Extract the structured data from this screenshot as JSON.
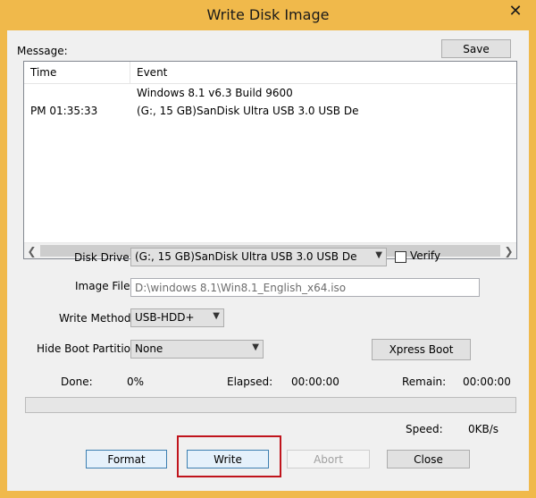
{
  "window": {
    "title": "Write Disk Image",
    "close_glyph": "✕"
  },
  "message_label": "Message:",
  "save_label": "Save",
  "log": {
    "columns": [
      "Time",
      "Event"
    ],
    "rows": [
      {
        "time": "",
        "event": "Windows 8.1 v6.3 Build 9600"
      },
      {
        "time": "PM 01:35:33",
        "event": "(G:, 15 GB)SanDisk Ultra USB 3.0 USB De"
      }
    ]
  },
  "disk_drive": {
    "label": "Disk Drive:",
    "value": "(G:, 15 GB)SanDisk Ultra USB 3.0 USB De"
  },
  "verify": {
    "label": "Verify",
    "checked": false
  },
  "image_file": {
    "label": "Image File:",
    "value": "D:\\windows 8.1\\Win8.1_English_x64.iso"
  },
  "write_method": {
    "label": "Write Method:",
    "value": "USB-HDD+"
  },
  "hide_boot": {
    "label": "Hide Boot Partition:",
    "value": "None"
  },
  "xpress_boot_label": "Xpress Boot",
  "status": {
    "done_label": "Done:",
    "done_value": "0%",
    "elapsed_label": "Elapsed:",
    "elapsed_value": "00:00:00",
    "remain_label": "Remain:",
    "remain_value": "00:00:00",
    "speed_label": "Speed:",
    "speed_value": "0KB/s"
  },
  "progress_fraction": 0.0,
  "buttons": {
    "format": "Format",
    "write": "Write",
    "abort": "Abort",
    "close": "Close"
  },
  "colors": {
    "title_bar": "#f0b94b",
    "highlight": "#c0141c"
  }
}
